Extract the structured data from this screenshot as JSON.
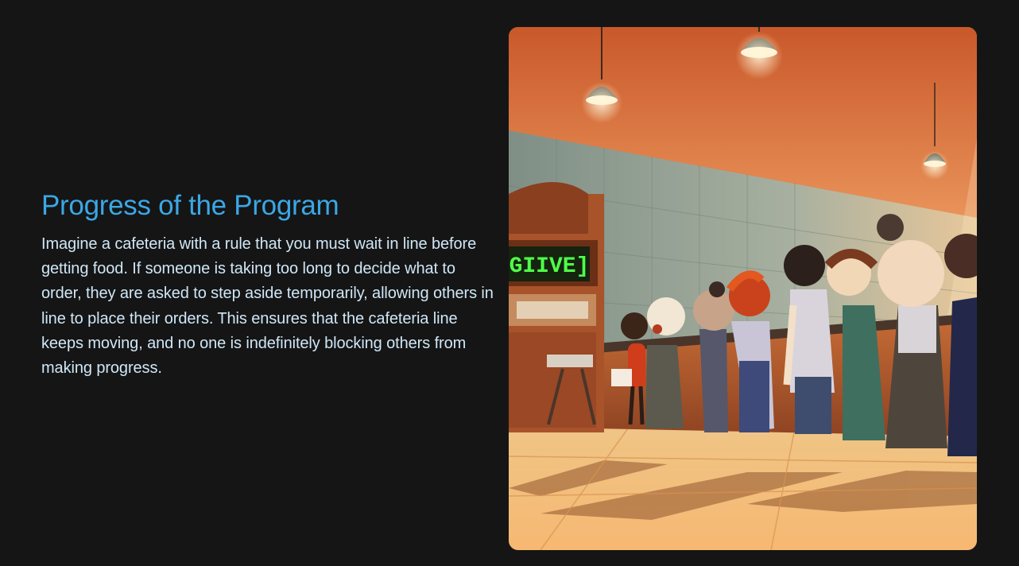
{
  "slide": {
    "title": "Progress of the Program",
    "body": "Imagine a cafeteria with a rule that you must wait in line before getting food. If someone is taking too long to decide what to order, they are asked to step aside temporarily, allowing others in line to place their orders. This ensures that the cafeteria line keeps moving, and no one is indefinitely blocking others from making progress.",
    "illustration": {
      "sign_text": "GIIVE]"
    }
  },
  "colors": {
    "background": "#151515",
    "title": "#3ba7e6",
    "body_text": "#cfe7f7"
  }
}
